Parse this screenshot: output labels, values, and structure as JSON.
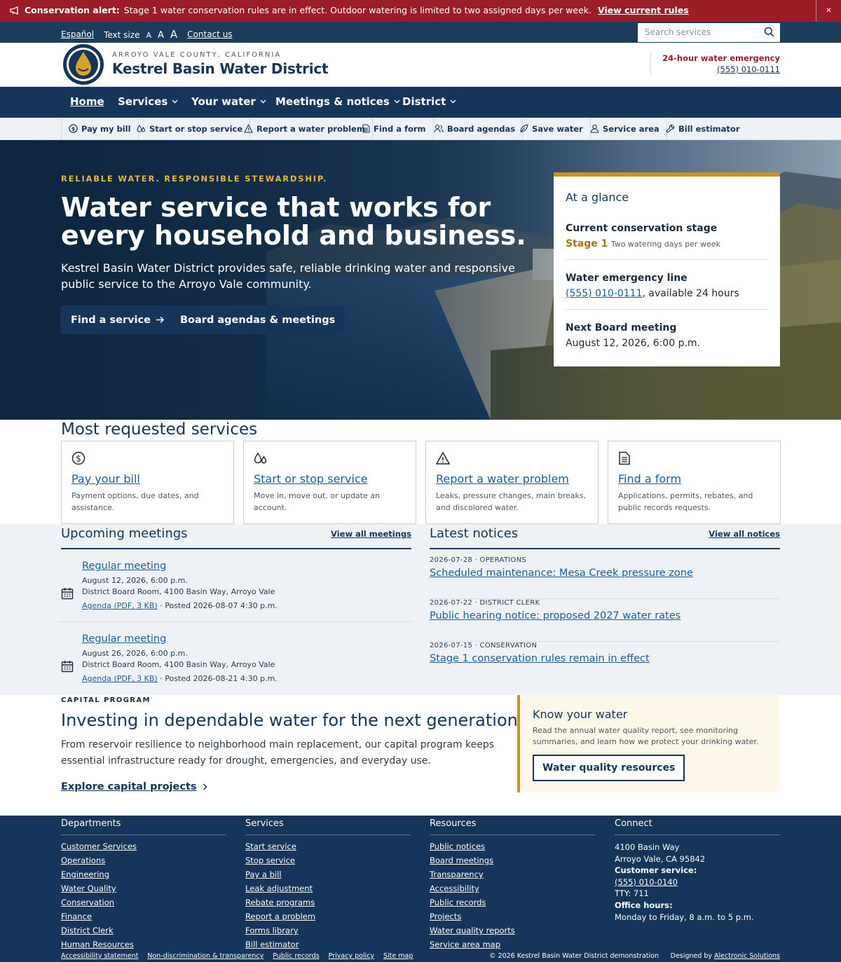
{
  "alert": {
    "label": "Conservation alert:",
    "message": "Stage 1 water conservation rules are in effect. Outdoor watering is limited to two assigned days per week.",
    "link": "View current rules",
    "close": "✕"
  },
  "utility": {
    "language": "Español",
    "text_size_label": "Text size",
    "size_small": "A",
    "size_medium": "A",
    "size_large": "A",
    "contact": "Contact us",
    "search_placeholder": "Search services"
  },
  "header": {
    "county": "ARROYO VALE COUNTY, CALIFORNIA",
    "district": "Kestrel Basin Water District",
    "emergency_label": "24-hour water emergency",
    "emergency_phone": "(555) 010-0111"
  },
  "nav": {
    "home": "Home",
    "services": "Services",
    "your_water": "Your water",
    "meetings": "Meetings & notices",
    "district": "District"
  },
  "quick_links": [
    "Pay my bill",
    "Start or stop service",
    "Report a water problem",
    "Find a form",
    "Board agendas",
    "Save water",
    "Service area",
    "Bill estimator"
  ],
  "hero": {
    "eyebrow": "RELIABLE WATER. RESPONSIBLE STEWARDSHIP.",
    "headline": "Water service that works for every household and business.",
    "lead": "Kestrel Basin Water District provides safe, reliable drinking water and responsive public service to the Arroyo Vale community.",
    "btn_find": "Find a service",
    "btn_board": "Board agendas & meetings"
  },
  "glance": {
    "title": "At a glance",
    "stage_label": "Current conservation stage",
    "stage_value": "Stage 1",
    "stage_note": "Two watering days per week",
    "emergency_label": "Water emergency line",
    "emergency_phone": "(555) 010-0111",
    "emergency_note": ", available 24 hours",
    "meeting_label": "Next Board meeting",
    "meeting_value": "August 12, 2026, 6:00 p.m."
  },
  "services": {
    "heading": "Most requested services",
    "cards": [
      {
        "title": "Pay your bill",
        "desc": "Payment options, due dates, and assistance."
      },
      {
        "title": "Start or stop service",
        "desc": "Move in, move out, or update an account."
      },
      {
        "title": "Report a water problem",
        "desc": "Leaks, pressure changes, main breaks, and discolored water."
      },
      {
        "title": "Find a form",
        "desc": "Applications, permits, rebates, and public records requests."
      }
    ]
  },
  "meetings": {
    "heading": "Upcoming meetings",
    "view_all": "View all meetings",
    "items": [
      {
        "title": "Regular meeting",
        "date": "August 12, 2026, 6:00 p.m.",
        "place": "District Board Room, 4100 Basin Way, Arroyo Vale",
        "agenda": "Agenda (PDF, 3 KB)",
        "posted": " · Posted 2026-08-07 4:30 p.m."
      },
      {
        "title": "Regular meeting",
        "date": "August 26, 2026, 6:00 p.m.",
        "place": "District Board Room, 4100 Basin Way, Arroyo Vale",
        "agenda": "Agenda (PDF, 3 KB)",
        "posted": " · Posted 2026-08-21 4:30 p.m."
      }
    ]
  },
  "notices": {
    "heading": "Latest notices",
    "view_all": "View all notices",
    "items": [
      {
        "meta": "2026-07-28 · OPERATIONS",
        "title": "Scheduled maintenance: Mesa Creek pressure zone"
      },
      {
        "meta": "2026-07-22 · DISTRICT CLERK",
        "title": "Public hearing notice: proposed 2027 water rates"
      },
      {
        "meta": "2026-07-15 · CONSERVATION",
        "title": "Stage 1 conservation rules remain in effect"
      }
    ]
  },
  "capital": {
    "eyebrow": "CAPITAL PROGRAM",
    "heading": "Investing in dependable water for the next generation",
    "body": "From reservoir resilience to neighborhood main replacement, our capital program keeps essential infrastructure ready for drought, emergencies, and everyday use.",
    "link": "Explore capital projects"
  },
  "know_water": {
    "heading": "Know your water",
    "body": "Read the annual water quality report, see monitoring summaries, and learn how we protect your drinking water.",
    "button": "Water quality resources"
  },
  "footer": {
    "departments": {
      "heading": "Departments",
      "items": [
        "Customer Services",
        "Operations",
        "Engineering",
        "Water Quality",
        "Conservation",
        "Finance",
        "District Clerk",
        "Human Resources"
      ]
    },
    "services": {
      "heading": "Services",
      "items": [
        "Start service",
        "Stop service",
        "Pay a bill",
        "Leak adjustment",
        "Rebate programs",
        "Report a problem",
        "Forms library",
        "Bill estimator"
      ]
    },
    "resources": {
      "heading": "Resources",
      "items": [
        "Public notices",
        "Board meetings",
        "Transparency",
        "Accessibility",
        "Public records",
        "Projects",
        "Water quality reports",
        "Service area map"
      ]
    },
    "connect": {
      "heading": "Connect",
      "address1": "4100 Basin Way",
      "address2": "Arroyo Vale, CA 95842",
      "cs_label": "Customer service:",
      "cs_phone": "(555) 010-0140",
      "tty": "TTY: 711",
      "hours_label": "Office hours:",
      "hours": "Monday to Friday, 8 a.m. to 5 p.m."
    }
  },
  "legal": {
    "links": [
      "Accessibility statement",
      "Non-discrimination & transparency",
      "Public records",
      "Privacy policy",
      "Site map"
    ],
    "copyright": "© 2026 Kestrel Basin Water District demonstration",
    "designed_by": "Designed by ",
    "designer": "Alectronic Solutions"
  },
  "colors": {
    "alert": "#9b1d28",
    "navy": "#15355a",
    "accent": "#c8931f",
    "link": "#1c5c9e"
  }
}
